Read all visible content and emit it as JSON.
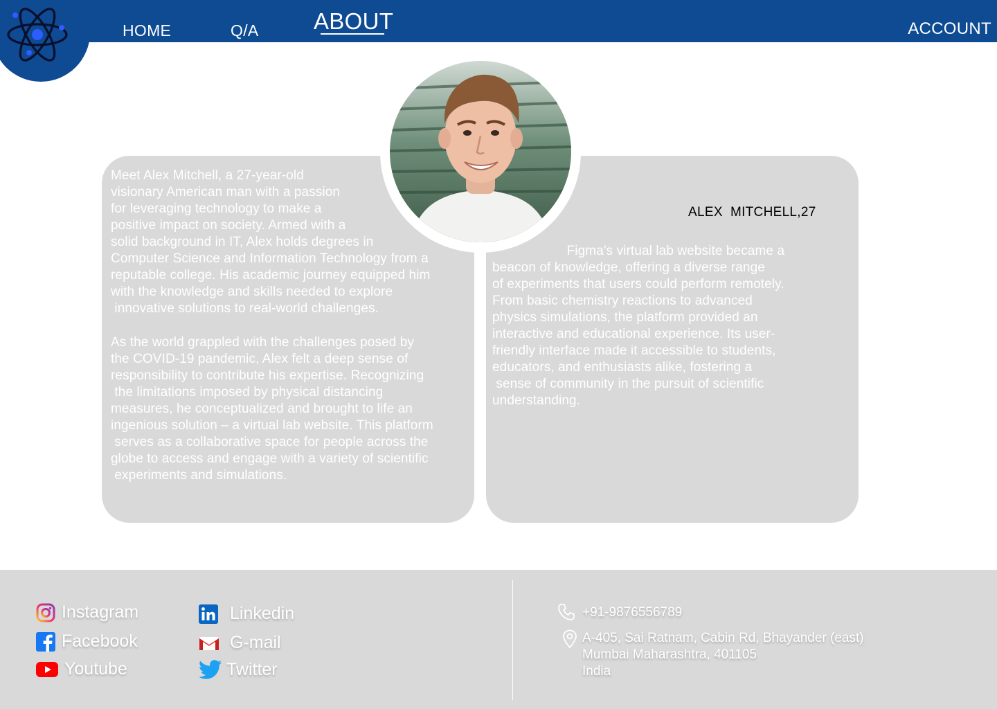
{
  "nav": {
    "home": "HOME",
    "qa": "Q/A",
    "about": "ABOUT",
    "account": "ACCOUNT"
  },
  "logo": {
    "icon": "atom-icon"
  },
  "profile": {
    "name": "ALEX  MITCHELL,27",
    "photo_icon": "profile-photo"
  },
  "bio": {
    "paragraph1": "Meet Alex Mitchell, a 27-year-old\nvisionary American man with a passion\nfor leveraging technology to make a\npositive impact on society. Armed with a\nsolid background in IT, Alex holds degrees in\nComputer Science and Information Technology from a\nreputable college. His academic journey equipped him\nwith the knowledge and skills needed to explore\n innovative solutions to real-world challenges.",
    "paragraph2": "As the world grappled with the challenges posed by\nthe COVID-19 pandemic, Alex felt a deep sense of\nresponsibility to contribute his expertise. Recognizing\n the limitations imposed by physical distancing\nmeasures, he conceptualized and brought to life an\ningenious solution – a virtual lab website. This platform\n serves as a collaborative space for people across the\nglobe to access and engage with a variety of scientific\n experiments and simulations.",
    "paragraph3": "                    Figma's virtual lab website became a\nbeacon of knowledge, offering a diverse range\nof experiments that users could perform remotely.\nFrom basic chemistry reactions to advanced\nphysics simulations, the platform provided an\ninteractive and educational experience. Its user-\nfriendly interface made it accessible to students,\neducators, and enthusiasts alike, fostering a\n sense of community in the pursuit of scientific\nunderstanding."
  },
  "footer": {
    "social": [
      {
        "label": "Instagram",
        "icon": "instagram-icon"
      },
      {
        "label": "Facebook",
        "icon": "facebook-icon"
      },
      {
        "label": "Youtube",
        "icon": "youtube-icon"
      },
      {
        "label": "Linkedin",
        "icon": "linkedin-icon"
      },
      {
        "label": "G-mail",
        "icon": "gmail-icon"
      },
      {
        "label": "Twitter",
        "icon": "twitter-icon"
      }
    ],
    "contact": {
      "phone": "+91-9876556789",
      "address_line1": "A-405, Sai Ratnam, Cabin Rd, Bhayander (east)",
      "address_line2": "Mumbai Maharashtra, 401105",
      "address_line3": "India"
    }
  },
  "colors": {
    "brand": "#0e4b93",
    "card": "#d9d9d9",
    "footer": "#d9d9d9"
  }
}
